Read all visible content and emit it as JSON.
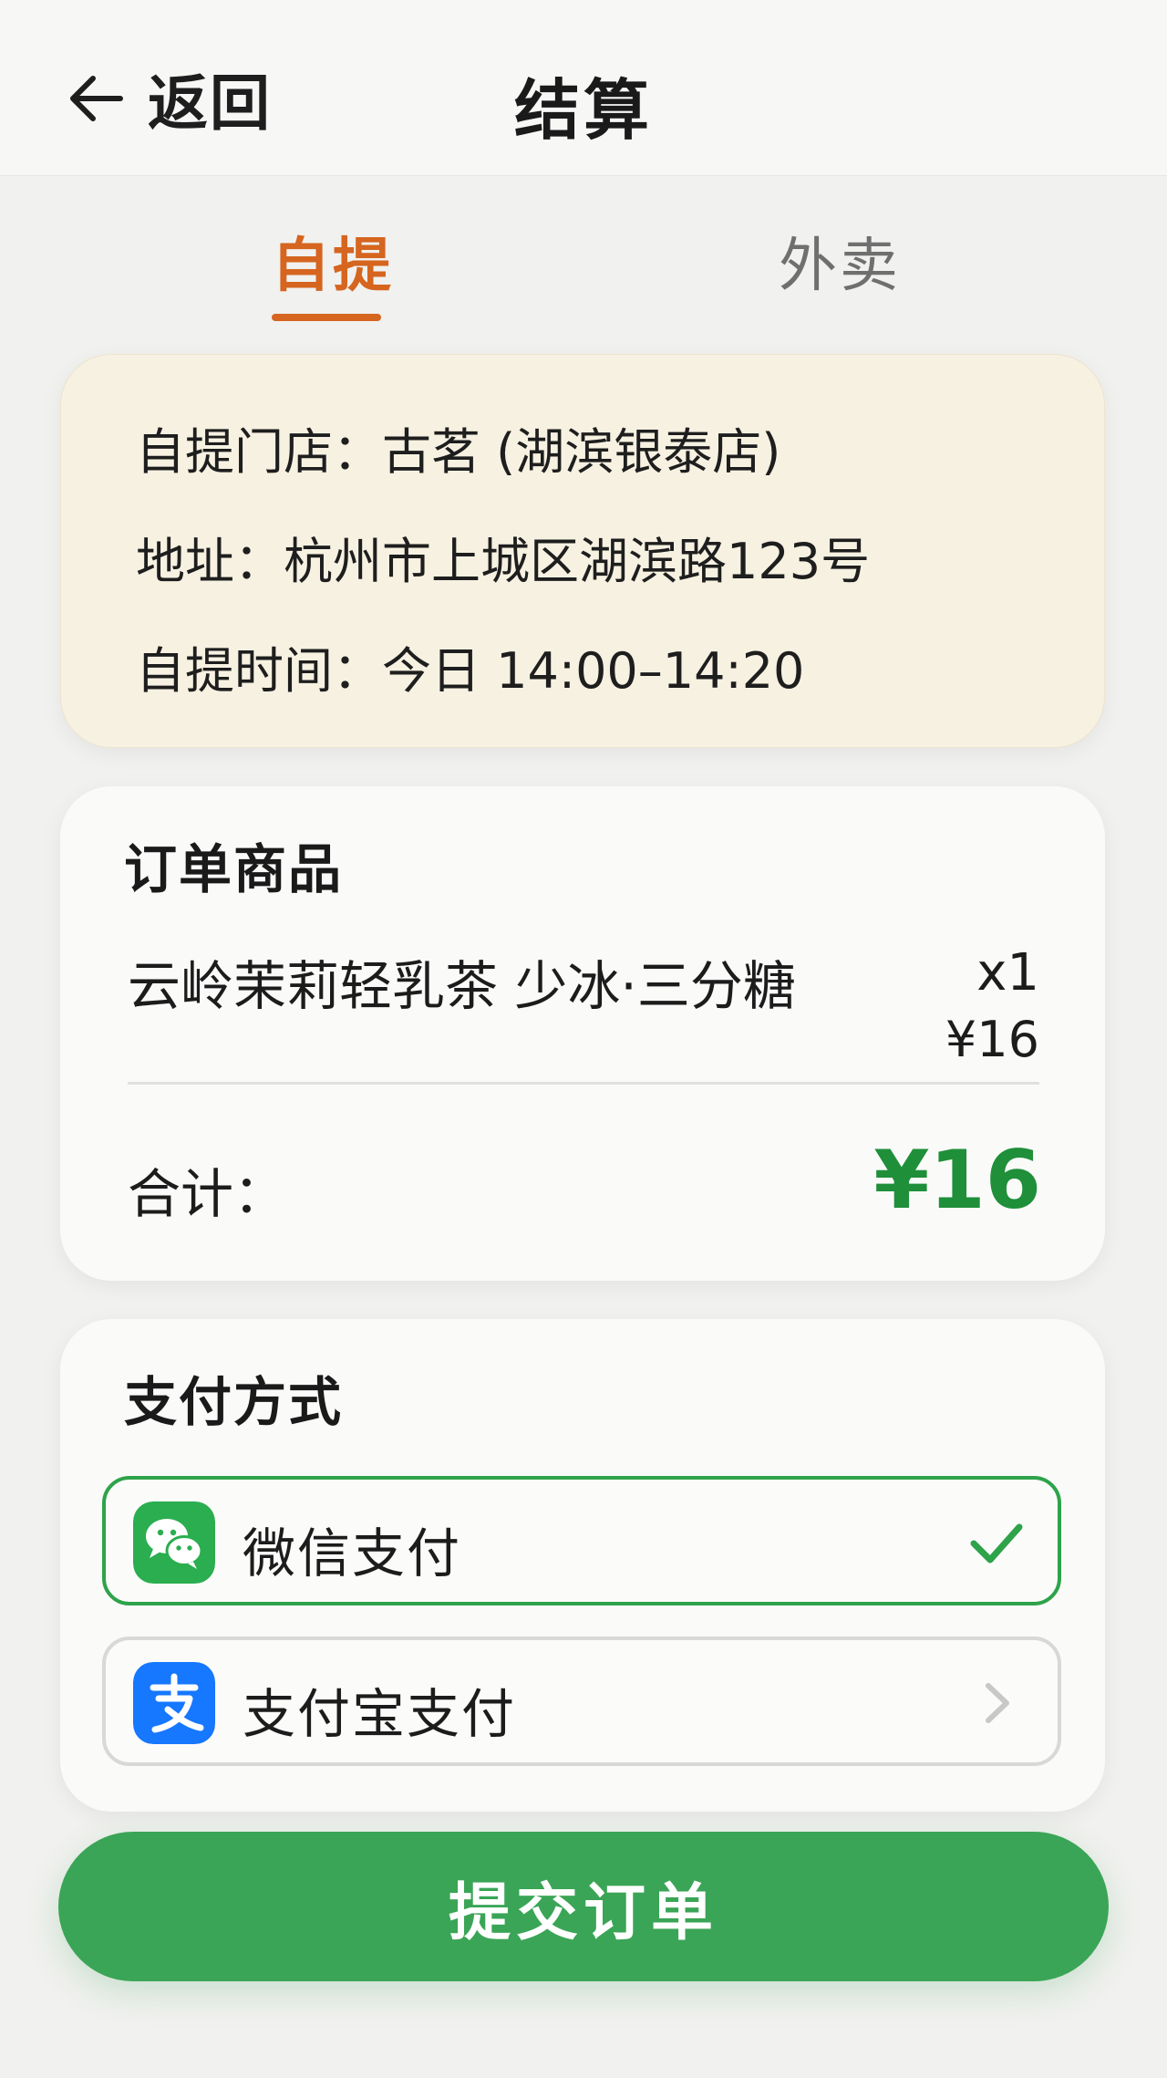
{
  "header": {
    "back_label": "返回",
    "title": "结算"
  },
  "tabs": [
    {
      "label": "自提",
      "active": true
    },
    {
      "label": "外卖",
      "active": false
    }
  ],
  "pickup": {
    "store_line": "自提门店：古茗 (湖滨银泰店)",
    "address_line": "地址：杭州市上城区湖滨路123号",
    "time_line": "自提时间：今日 14:00–14:20"
  },
  "order": {
    "section_title": "订单商品",
    "items": [
      {
        "name": "云岭茉莉轻乳茶 少冰·三分糖",
        "qty": "x1",
        "price": "¥16"
      }
    ],
    "total_label": "合计：",
    "total_value": "¥16"
  },
  "payment": {
    "section_title": "支付方式",
    "options": [
      {
        "label": "微信支付",
        "icon": "wechat-pay-icon",
        "selected": true
      },
      {
        "label": "支付宝支付",
        "icon": "alipay-icon",
        "selected": false
      }
    ]
  },
  "submit": {
    "label": "提交订单"
  },
  "colors": {
    "accent": "#d5651f",
    "primary_green": "#3aa556",
    "price_green": "#1f8f3a",
    "store_card_bg": "#f7f1e2",
    "alipay_blue": "#1677ff"
  }
}
